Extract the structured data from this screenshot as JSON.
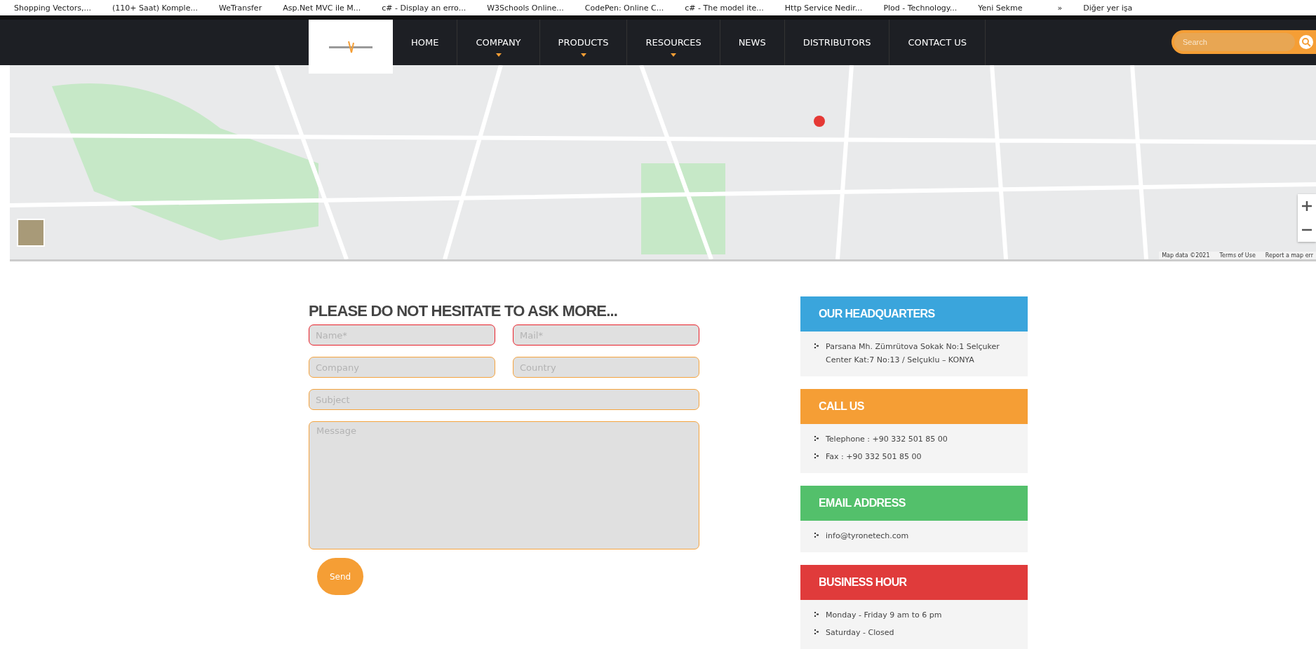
{
  "bookmarks_bar": {
    "items": [
      "Shopping Vectors,...",
      "(110+ Saat) Komple...",
      "WeTransfer",
      "Asp.Net MVC ile M...",
      "c# - Display an erro...",
      "W3Schools Online...",
      "CodePen: Online C...",
      "c# - The model ite...",
      "Http Service Nedir...",
      "Plod - Technology...",
      "Yeni Sekme"
    ],
    "more": "»",
    "other": "Diğer yer işa"
  },
  "nav": {
    "items": [
      {
        "label": "HOME",
        "dropdown": false
      },
      {
        "label": "COMPANY",
        "dropdown": true
      },
      {
        "label": "PRODUCTS",
        "dropdown": true
      },
      {
        "label": "RESOURCES",
        "dropdown": true
      },
      {
        "label": "NEWS",
        "dropdown": false
      },
      {
        "label": "DISTRIBUTORS",
        "dropdown": false
      },
      {
        "label": "CONTACT US",
        "dropdown": false
      }
    ],
    "search": {
      "placeholder": "Search"
    }
  },
  "map": {
    "attribution": [
      "Map data ©2021",
      "Terms of Use",
      "Report a map err"
    ]
  },
  "form": {
    "title": "PLEASE DO NOT HESITATE TO ASK MORE...",
    "fields": [
      {
        "placeholder": "Name*",
        "required": true,
        "kind": "half"
      },
      {
        "placeholder": "Mail*",
        "required": true,
        "kind": "half"
      },
      {
        "placeholder": "Company",
        "required": false,
        "kind": "half"
      },
      {
        "placeholder": "Country",
        "required": false,
        "kind": "half"
      },
      {
        "placeholder": "Subject",
        "required": false,
        "kind": "full"
      },
      {
        "placeholder": "Message",
        "required": false,
        "kind": "area"
      }
    ],
    "submit": "Send"
  },
  "info_cards": [
    {
      "title": "OUR HEADQUARTERS",
      "color": "#3aa5dc",
      "lines": [
        "Parsana Mh. Zümrütova Sokak No:1 Selçuker Center Kat:7 No:13 / Selçuklu – KONYA"
      ]
    },
    {
      "title": "CALL US",
      "color": "#f59e35",
      "lines": [
        "Telephone : +90 332 501 85 00",
        "Fax : +90 332 501 85 00"
      ]
    },
    {
      "title": "EMAIL ADDRESS",
      "color": "#53c06b",
      "lines": [
        "info@tyronetech.com"
      ]
    },
    {
      "title": "BUSINESS HOUR",
      "color": "#e03b3b",
      "lines": [
        "Monday - Friday 9 am to 6 pm",
        "Saturday - Closed"
      ]
    }
  ]
}
